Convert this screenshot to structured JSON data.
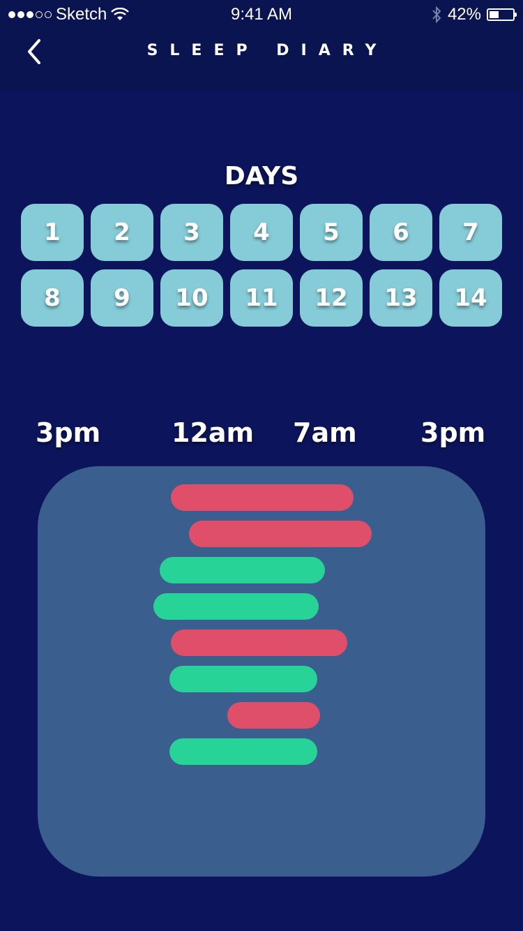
{
  "status_bar": {
    "carrier": "Sketch",
    "time": "9:41 AM",
    "battery_text": "42%",
    "battery_level": 0.42
  },
  "header": {
    "title": "SLEEP DIARY"
  },
  "days": {
    "title": "DAYS",
    "items": [
      "1",
      "2",
      "3",
      "4",
      "5",
      "6",
      "7",
      "8",
      "9",
      "10",
      "11",
      "12",
      "13",
      "14"
    ]
  },
  "colors": {
    "background": "#0c155c",
    "day_button": "#86ccd8",
    "panel": "#3a5e8d",
    "bar_red": "#e04f69",
    "bar_green": "#27d397"
  },
  "chart_data": {
    "type": "bar",
    "orientation": "horizontal-range",
    "x_tick_labels": [
      "3pm",
      "12am",
      "7am",
      "3pm"
    ],
    "x_tick_hours": [
      0,
      9,
      16,
      24
    ],
    "x_axis_start": "3pm",
    "series": [
      {
        "status": "red",
        "start_hour": 6.4,
        "end_hour": 17.8
      },
      {
        "status": "red",
        "start_hour": 7.5,
        "end_hour": 18.9
      },
      {
        "status": "green",
        "start_hour": 5.7,
        "end_hour": 16.0
      },
      {
        "status": "green",
        "start_hour": 5.3,
        "end_hour": 15.6
      },
      {
        "status": "red",
        "start_hour": 6.4,
        "end_hour": 17.4
      },
      {
        "status": "green",
        "start_hour": 6.3,
        "end_hour": 15.5
      },
      {
        "status": "red",
        "start_hour": 9.9,
        "end_hour": 15.7
      },
      {
        "status": "green",
        "start_hour": 6.3,
        "end_hour": 15.5
      }
    ]
  }
}
